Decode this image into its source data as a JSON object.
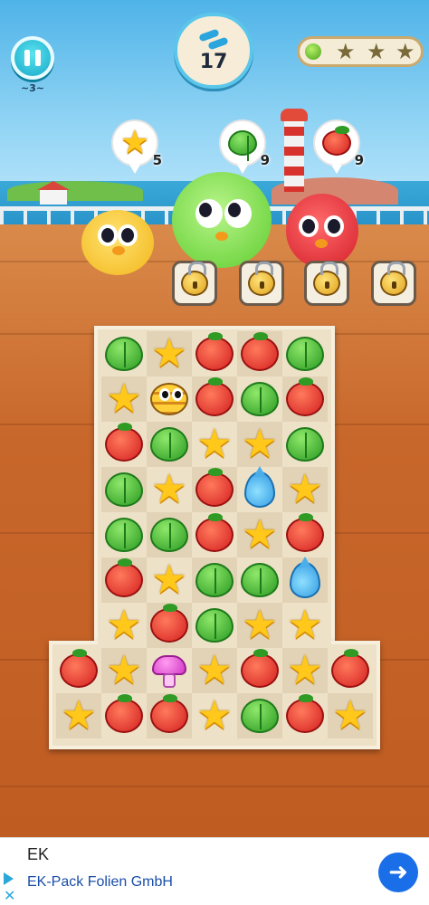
{
  "hud": {
    "pause_sub": "~3~",
    "moves": "17",
    "stars_earned": 0,
    "stars_total": 3
  },
  "goals": [
    {
      "type": "star",
      "count": "5"
    },
    {
      "type": "leaf",
      "count": "9"
    },
    {
      "type": "tomato",
      "count": "9"
    }
  ],
  "board": {
    "rows": [
      [
        "",
        "",
        "leaf",
        "star",
        "tomato",
        "tomato",
        "leaf",
        "",
        ""
      ],
      [
        "",
        "",
        "star",
        "bee",
        "tomato",
        "leaf",
        "tomato",
        "",
        ""
      ],
      [
        "",
        "",
        "tomato",
        "leaf",
        "star",
        "star",
        "leaf",
        "",
        ""
      ],
      [
        "",
        "",
        "leaf",
        "star",
        "tomato",
        "drop",
        "star",
        "",
        ""
      ],
      [
        "",
        "",
        "leaf",
        "leaf",
        "tomato",
        "star",
        "tomato",
        "",
        ""
      ],
      [
        "",
        "",
        "tomato",
        "star",
        "leaf",
        "leaf",
        "drop",
        "",
        ""
      ],
      [
        "",
        "",
        "star",
        "tomato",
        "leaf",
        "star",
        "star",
        "",
        ""
      ],
      [
        "",
        "tomato",
        "star",
        "mushroom",
        "star",
        "tomato",
        "star",
        "tomato",
        ""
      ],
      [
        "",
        "star",
        "tomato",
        "tomato",
        "star",
        "leaf",
        "tomato",
        "star",
        ""
      ]
    ]
  },
  "ad": {
    "title": "EK",
    "subtitle": "EK-Pack Folien GmbH"
  },
  "colors": {
    "deck": "#c96a2c",
    "board": "#ede1c7",
    "accent": "#17a9c9",
    "ad_cta": "#1a6ee8"
  }
}
